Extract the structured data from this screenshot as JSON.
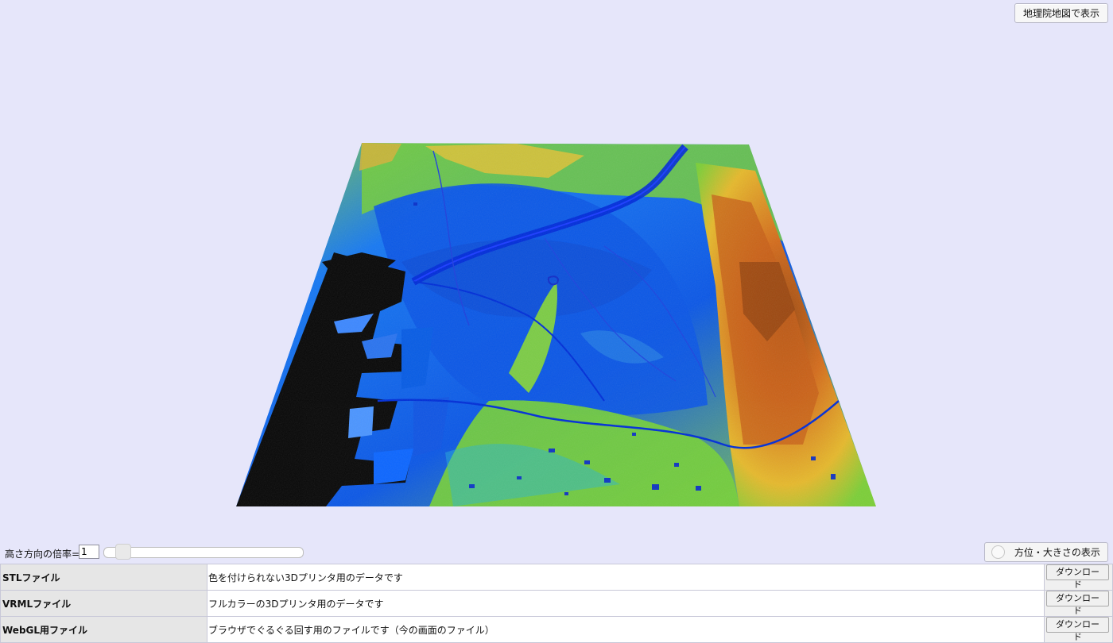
{
  "top_button": {
    "label": "地理院地図で表示"
  },
  "terrain": {
    "name": "3D terrain model preview",
    "colors": {
      "water": "#0033d9",
      "dark_low": "#070707",
      "blue": "#0b57e6",
      "light_blue": "#3c8cff",
      "cyan": "#36c9d9",
      "green": "#67c93b",
      "yellow_green": "#c9d63b",
      "orange": "#e48b20",
      "brown": "#a24f12"
    }
  },
  "controls": {
    "height_ratio_label": "高さ方向の倍率=",
    "height_ratio_value": "1",
    "slider_value": 0.08,
    "compass_button_label": "方位・大きさの表示"
  },
  "files": [
    {
      "name": "STLファイル",
      "description": "色を付けられない3Dプリンタ用のデータです",
      "action": "ダウンロード"
    },
    {
      "name": "VRMLファイル",
      "description": "フルカラーの3Dプリンタ用のデータです",
      "action": "ダウンロード"
    },
    {
      "name": "WebGL用ファイル",
      "description": "ブラウザでぐるぐる回す用のファイルです（今の画面のファイル）",
      "action": "ダウンロード"
    }
  ]
}
